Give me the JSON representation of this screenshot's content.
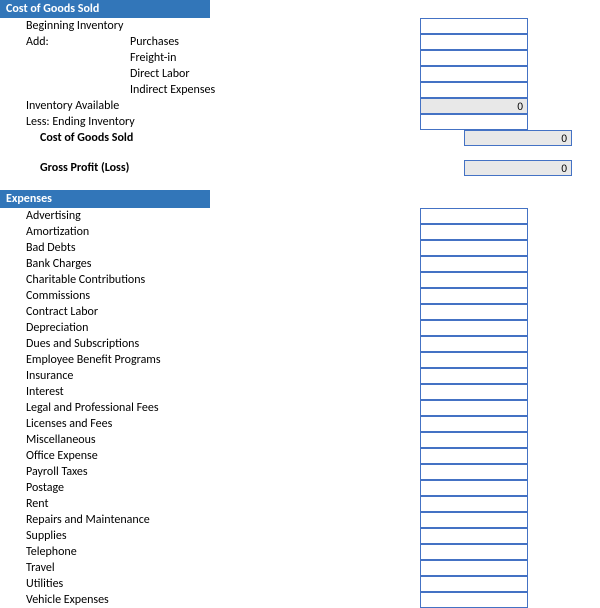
{
  "cogs": {
    "header": "Cost of Goods Sold",
    "beginning_inventory": "Beginning Inventory",
    "add": "Add:",
    "purchases": "Purchases",
    "freight_in": "Freight-in",
    "direct_labor": "Direct Labor",
    "indirect_expenses": "Indirect Expenses",
    "inventory_available": "Inventory Available",
    "inventory_available_value": "0",
    "less_ending_inventory": "Less: Ending Inventory",
    "cost_of_goods_sold": "Cost of Goods Sold",
    "cost_of_goods_sold_value": "0",
    "gross_profit": "Gross Profit (Loss)",
    "gross_profit_value": "0"
  },
  "expenses": {
    "header": "Expenses",
    "items": [
      "Advertising",
      "Amortization",
      "Bad Debts",
      "Bank Charges",
      "Charitable Contributions",
      "Commissions",
      "Contract Labor",
      "Depreciation",
      "Dues and Subscriptions",
      "Employee Benefit Programs",
      "Insurance",
      "Interest",
      "Legal and Professional Fees",
      "Licenses and Fees",
      "Miscellaneous",
      "Office Expense",
      "Payroll Taxes",
      "Postage",
      "Rent",
      "Repairs and Maintenance",
      "Supplies",
      "Telephone",
      "Travel",
      "Utilities",
      "Vehicle Expenses"
    ]
  }
}
